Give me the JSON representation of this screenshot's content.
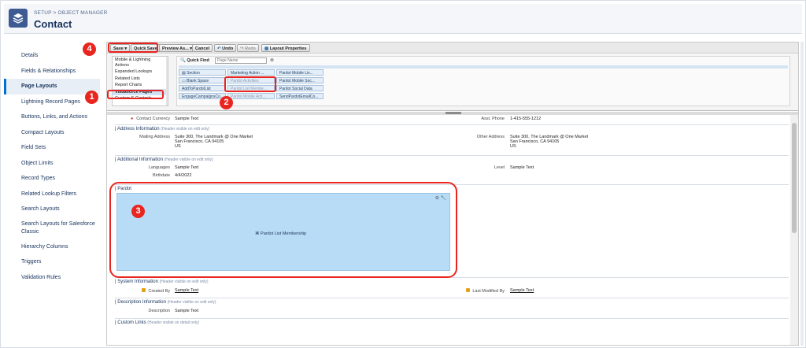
{
  "header": {
    "breadcrumb": "SETUP > OBJECT MANAGER",
    "title": "Contact"
  },
  "sidebar": {
    "items": [
      {
        "label": "Details"
      },
      {
        "label": "Fields & Relationships"
      },
      {
        "label": "Page Layouts",
        "active": true
      },
      {
        "label": "Lightning Record Pages"
      },
      {
        "label": "Buttons, Links, and Actions"
      },
      {
        "label": "Compact Layouts"
      },
      {
        "label": "Field Sets"
      },
      {
        "label": "Object Limits"
      },
      {
        "label": "Record Types"
      },
      {
        "label": "Related Lookup Filters"
      },
      {
        "label": "Search Layouts"
      },
      {
        "label": "Search Layouts for Salesforce Classic"
      },
      {
        "label": "Hierarchy Columns"
      },
      {
        "label": "Triggers"
      },
      {
        "label": "Validation Rules"
      }
    ]
  },
  "toolbar": {
    "save": "Save",
    "quick_save": "Quick Save",
    "preview_as": "Preview As...",
    "cancel": "Cancel",
    "undo": "Undo",
    "redo": "Redo",
    "layout_properties": "Layout Properties"
  },
  "palette": {
    "categories": [
      {
        "label": "Mobile & Lightning Actions"
      },
      {
        "label": "Expanded Lookups"
      },
      {
        "label": "Related Lists"
      },
      {
        "label": "Report Charts"
      },
      {
        "label": "Visualforce Pages",
        "selected": true
      },
      {
        "label": "Custom S-Controls"
      }
    ],
    "quick_find_label": "Quick Find",
    "quick_find_placeholder": "Page Name",
    "items": {
      "col1": [
        "Section",
        "Blank Space",
        "AddToPardotList",
        "EngageCampaignsCo..."
      ],
      "col2": [
        "Marketing Action ...",
        "Pardot Activities",
        "Pardot List Membe...",
        "Pardot Mobile Acti..."
      ],
      "col3": [
        "Pardot Mobile Lis...",
        "Pardot Mobile Soc...",
        "Pardot Social Data",
        "SendPardotEmailCo..."
      ]
    }
  },
  "layout": {
    "contact_currency_label": "Contact Currency",
    "contact_currency_value": "Sample Text",
    "asst_phone_label": "Asst. Phone",
    "asst_phone_value": "1-415-555-1212",
    "address_section": "Address Information",
    "address_hint": "(Header visible on edit only)",
    "mailing_label": "Mailing Address",
    "mailing_value_1": "Suite 300, The Landmark @ One Market",
    "mailing_value_2": "San Francisco, CA 94105",
    "mailing_value_3": "US",
    "other_label": "Other Address",
    "other_value_1": "Suite 300, The Landmark @ One Market",
    "other_value_2": "San Francisco, CA 94105",
    "other_value_3": "US",
    "additional_section": "Additional Information",
    "additional_hint": "(Header visible on edit only)",
    "languages_label": "Languages",
    "languages_value": "Sample Text",
    "level_label": "Level",
    "level_value": "Sample Text",
    "birthdate_label": "Birthdate",
    "birthdate_value": "4/4/2022",
    "pardot_section": "Pardot",
    "vf_label": "Pardot List Membership",
    "system_section": "System Information",
    "system_hint": "(Header visible on edit only)",
    "created_by_label": "Created By",
    "created_by_value": "Sample Text",
    "last_modified_label": "Last Modified By",
    "last_modified_value": "Sample Text",
    "description_section": "Description Information",
    "description_hint": "(Header visible on edit only)",
    "description_label": "Description",
    "description_value": "Sample Text",
    "custom_links_section": "Custom Links",
    "custom_links_hint": "(Header visible on detail only)"
  },
  "callouts": {
    "one": "1",
    "two": "2",
    "three": "3",
    "four": "4"
  },
  "colors": {
    "callout": "#e8251f",
    "accent": "#0070d2",
    "vf_component": "#b9dcf6"
  }
}
